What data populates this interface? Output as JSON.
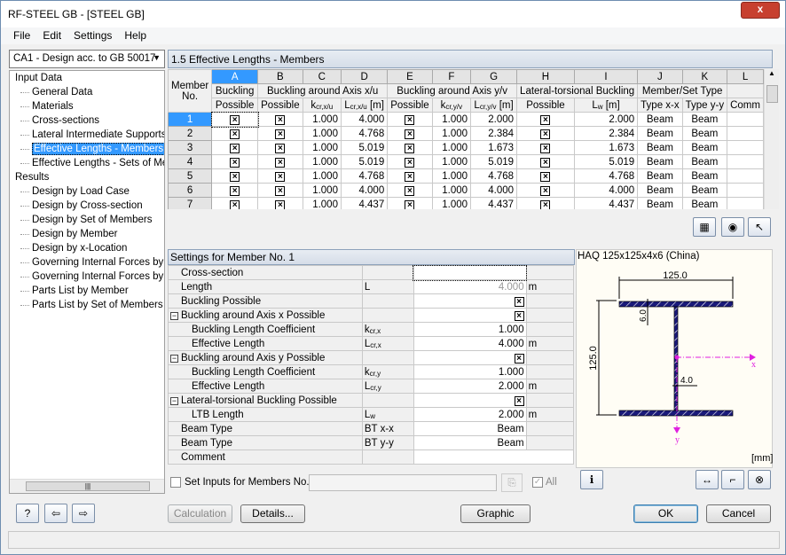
{
  "window": {
    "title": "RF-STEEL GB - [STEEL GB]",
    "close": "x"
  },
  "menu": [
    "File",
    "Edit",
    "Settings",
    "Help"
  ],
  "case_select": "CA1 - Design acc. to GB 50017",
  "tree": [
    {
      "label": "Input Data",
      "level": 0
    },
    {
      "label": "General Data",
      "level": 1
    },
    {
      "label": "Materials",
      "level": 1
    },
    {
      "label": "Cross-sections",
      "level": 1
    },
    {
      "label": "Lateral Intermediate Supports",
      "level": 1
    },
    {
      "label": "Effective Lengths - Members",
      "level": 1,
      "selected": true
    },
    {
      "label": "Effective Lengths - Sets of Members",
      "level": 1
    },
    {
      "label": "Results",
      "level": 0
    },
    {
      "label": "Design by Load Case",
      "level": 1
    },
    {
      "label": "Design by Cross-section",
      "level": 1
    },
    {
      "label": "Design by Set of Members",
      "level": 1
    },
    {
      "label": "Design by Member",
      "level": 1
    },
    {
      "label": "Design by x-Location",
      "level": 1
    },
    {
      "label": "Governing Internal Forces by Member",
      "level": 1
    },
    {
      "label": "Governing Internal Forces by Set of Members",
      "level": 1
    },
    {
      "label": "Parts List by Member",
      "level": 1
    },
    {
      "label": "Parts List by Set of Members",
      "level": 1
    }
  ],
  "section_title": "1.5 Effective Lengths - Members",
  "grid": {
    "letters": [
      "A",
      "B",
      "C",
      "D",
      "E",
      "F",
      "G",
      "H",
      "I",
      "J",
      "K",
      "L"
    ],
    "member_no": [
      "Member",
      "No."
    ],
    "group": {
      "a": "Buckling",
      "x": "Buckling around Axis x/u",
      "y": "Buckling around Axis y/v",
      "ltb": "Lateral-torsional Buckling",
      "type": "Member/Set Type"
    },
    "sub": {
      "a": "Possible",
      "b": "Possible",
      "c": "k",
      "c_sub": "cr,x/u",
      "d": "L",
      "d_sub": "cr,x/u",
      "d_unit": "[m]",
      "e": "Possible",
      "f": "k",
      "f_sub": "cr,y/v",
      "g": "L",
      "g_sub": "cr,y/v",
      "g_unit": "[m]",
      "h": "Possible",
      "i": "L",
      "i_sub": "w",
      "i_unit": "[m]",
      "j": "Type x-x",
      "k": "Type y-y",
      "l": "Comm"
    },
    "rows": [
      {
        "no": "1",
        "kx": "1.000",
        "lx": "4.000",
        "ky": "1.000",
        "ly": "2.000",
        "lw": "2.000",
        "tx": "Beam",
        "ty": "Beam"
      },
      {
        "no": "2",
        "kx": "1.000",
        "lx": "4.768",
        "ky": "1.000",
        "ly": "2.384",
        "lw": "2.384",
        "tx": "Beam",
        "ty": "Beam"
      },
      {
        "no": "3",
        "kx": "1.000",
        "lx": "5.019",
        "ky": "1.000",
        "ly": "1.673",
        "lw": "1.673",
        "tx": "Beam",
        "ty": "Beam"
      },
      {
        "no": "4",
        "kx": "1.000",
        "lx": "5.019",
        "ky": "1.000",
        "ly": "5.019",
        "lw": "5.019",
        "tx": "Beam",
        "ty": "Beam"
      },
      {
        "no": "5",
        "kx": "1.000",
        "lx": "4.768",
        "ky": "1.000",
        "ly": "4.768",
        "lw": "4.768",
        "tx": "Beam",
        "ty": "Beam"
      },
      {
        "no": "6",
        "kx": "1.000",
        "lx": "4.000",
        "ky": "1.000",
        "ly": "4.000",
        "lw": "4.000",
        "tx": "Beam",
        "ty": "Beam"
      },
      {
        "no": "7",
        "kx": "1.000",
        "lx": "4.437",
        "ky": "1.000",
        "ly": "4.437",
        "lw": "4.437",
        "tx": "Beam",
        "ty": "Beam"
      }
    ]
  },
  "settings": {
    "title": "Settings for Member No. 1",
    "rows": [
      {
        "name": "Cross-section",
        "sym": "",
        "val": "",
        "unit": ""
      },
      {
        "name": "Length",
        "sym": "L",
        "val": "4.000",
        "unit": "m"
      },
      {
        "name": "Buckling Possible",
        "sym": "",
        "val": "☒",
        "unit": ""
      },
      {
        "name": "Buckling around Axis x Possible",
        "sym": "",
        "val": "☒",
        "unit": "",
        "group": true
      },
      {
        "name": "Buckling Length Coefficient",
        "sym": "k",
        "sub": "cr,x",
        "val": "1.000",
        "unit": "",
        "child": true
      },
      {
        "name": "Effective Length",
        "sym": "L",
        "sub": "cr,x",
        "val": "4.000",
        "unit": "m",
        "child": true
      },
      {
        "name": "Buckling around Axis y Possible",
        "sym": "",
        "val": "☒",
        "unit": "",
        "group": true
      },
      {
        "name": "Buckling Length Coefficient",
        "sym": "k",
        "sub": "cr,y",
        "val": "1.000",
        "unit": "",
        "child": true
      },
      {
        "name": "Effective Length",
        "sym": "L",
        "sub": "cr,y",
        "val": "2.000",
        "unit": "m",
        "child": true
      },
      {
        "name": "Lateral-torsional Buckling Possible",
        "sym": "",
        "val": "☒",
        "unit": "",
        "group": true
      },
      {
        "name": "LTB Length",
        "sym": "L",
        "sub": "w",
        "val": "2.000",
        "unit": "m",
        "child": true
      },
      {
        "name": "Beam Type",
        "sym": "BT x-x",
        "val": "Beam",
        "unit": ""
      },
      {
        "name": "Beam Type",
        "sym": "BT y-y",
        "val": "Beam",
        "unit": ""
      },
      {
        "name": "Comment",
        "sym": "",
        "val": "",
        "unit": ""
      }
    ],
    "set_inputs_label": "Set Inputs for Members No.:",
    "set_inputs_value": "",
    "all_label": "All"
  },
  "cross_section": {
    "title": "HAQ 125x125x4x6 (China)",
    "width": "125.0",
    "height": "125.0",
    "flange_t": "6.0",
    "web_t": "4.0",
    "axis_x": "x",
    "axis_y": "y",
    "unit": "[mm]",
    "colors": {
      "section": "#1a1a7a",
      "axes": "#e020e0"
    }
  },
  "buttons": {
    "calculation": "Calculation",
    "details": "Details...",
    "graphic": "Graphic",
    "ok": "OK",
    "cancel": "Cancel"
  }
}
